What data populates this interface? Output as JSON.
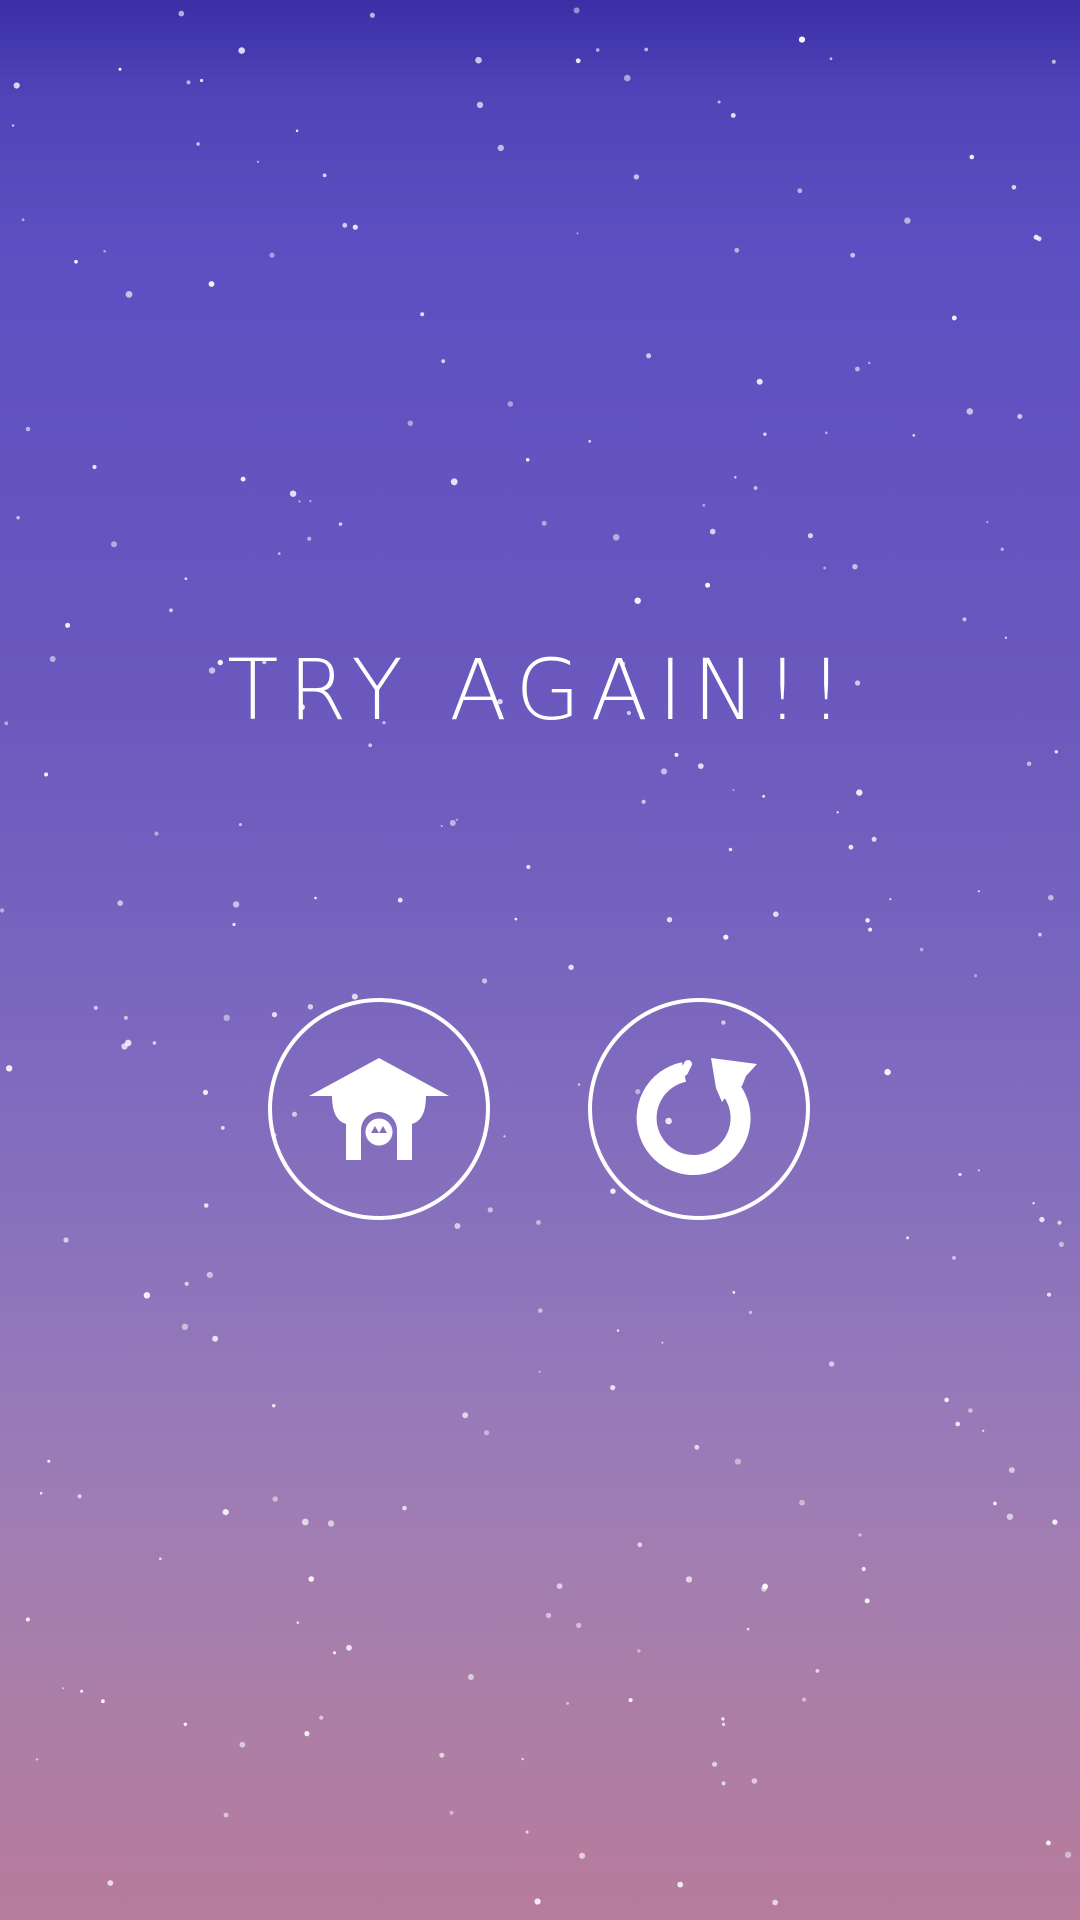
{
  "screen": {
    "title": "TRY AGAIN!!"
  },
  "buttons": {
    "home": {
      "icon": "home-icon"
    },
    "retry": {
      "icon": "retry-icon"
    }
  },
  "colors": {
    "background_top": "#3a2fa6",
    "background_mid": "#6a58be",
    "background_bottom": "#b87c9c",
    "foreground": "#ffffff"
  }
}
